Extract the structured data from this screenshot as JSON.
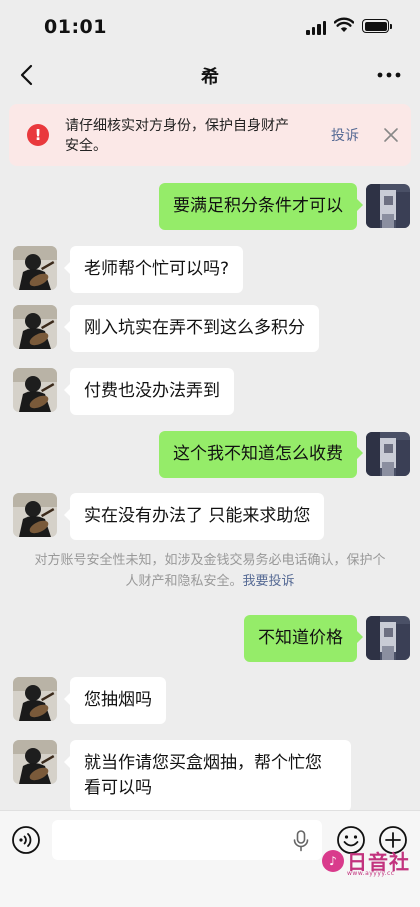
{
  "status": {
    "time": "01:01"
  },
  "nav": {
    "title": "希"
  },
  "warning": {
    "text": "请仔细核实对方身份，保护自身财产安全。",
    "report": "投诉"
  },
  "messages": [
    {
      "side": "out",
      "text": "要满足积分条件才可以"
    },
    {
      "side": "in",
      "text": "老师帮个忙可以吗?"
    },
    {
      "side": "in",
      "text": "刚入坑实在弄不到这么多积分"
    },
    {
      "side": "in",
      "text": "付费也没办法弄到"
    },
    {
      "side": "out",
      "text": "这个我不知道怎么收费"
    },
    {
      "side": "in",
      "text": "实在没有办法了 只能来求助您"
    },
    {
      "side": "out",
      "text": "不知道价格"
    },
    {
      "side": "in",
      "text": "您抽烟吗"
    },
    {
      "side": "in",
      "text": "就当作请您买盒烟抽，帮个忙您看可以吗"
    }
  ],
  "system_notice": {
    "text": "对方账号安全性未知，如涉及金钱交易务必电话确认，保护个人财产和隐私安全。",
    "link": "我要投诉"
  },
  "watermark": {
    "text": "日音社",
    "sub": "www.ayyyy.cc"
  },
  "colors": {
    "outgoing_bubble": "#95ec69",
    "incoming_bubble": "#ffffff",
    "warning_bg": "#fbe8e7",
    "link": "#576b95"
  }
}
